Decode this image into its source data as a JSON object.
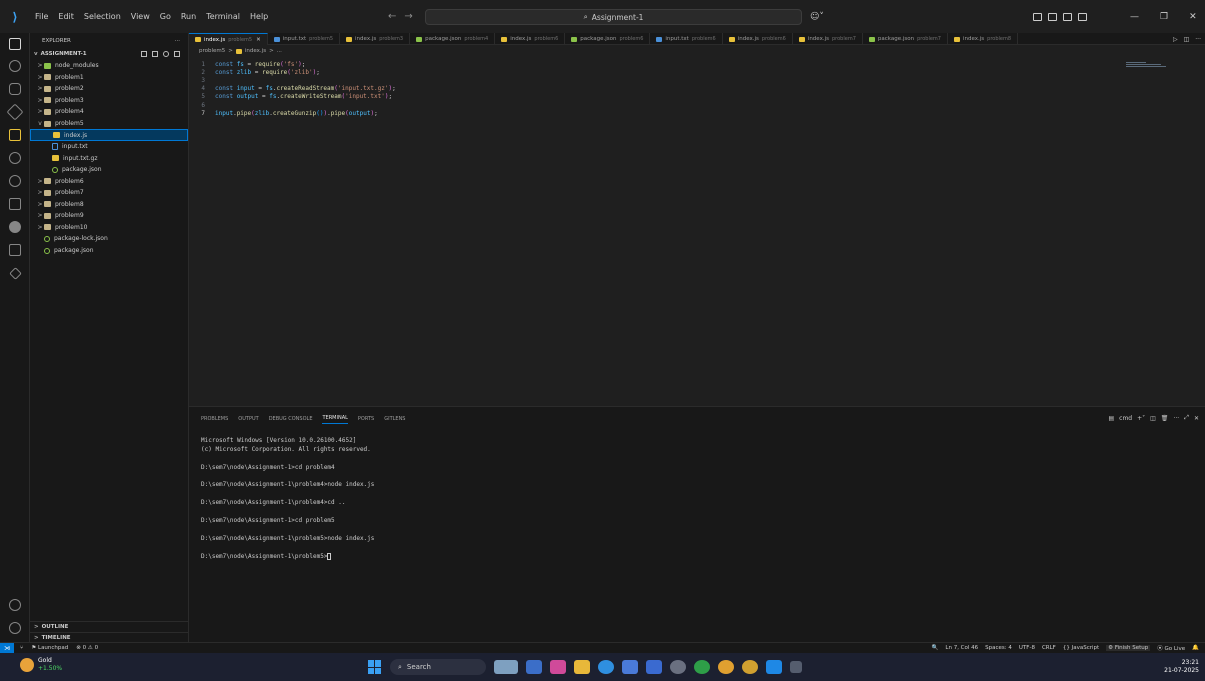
{
  "titlebar": {
    "menu": [
      "File",
      "Edit",
      "Selection",
      "View",
      "Go",
      "Run",
      "Terminal",
      "Help"
    ],
    "search_text": "Assignment-1"
  },
  "sidebar": {
    "header": "EXPLORER",
    "header_more": "···",
    "root": "ASSIGNMENT-1",
    "items": [
      {
        "label": "node_modules",
        "type": "nm",
        "indent": 1,
        "chev": ">"
      },
      {
        "label": "problem1",
        "type": "folder",
        "indent": 1,
        "chev": ">"
      },
      {
        "label": "problem2",
        "type": "folder",
        "indent": 1,
        "chev": ">"
      },
      {
        "label": "problem3",
        "type": "folder",
        "indent": 1,
        "chev": ">"
      },
      {
        "label": "problem4",
        "type": "folder",
        "indent": 1,
        "chev": ">"
      },
      {
        "label": "problem5",
        "type": "folder",
        "indent": 1,
        "chev": "v"
      },
      {
        "label": "index.js",
        "type": "js",
        "indent": 2,
        "chev": "",
        "selected": true
      },
      {
        "label": "input.txt",
        "type": "txt",
        "indent": 2,
        "chev": ""
      },
      {
        "label": "input.txt.gz",
        "type": "gz",
        "indent": 2,
        "chev": ""
      },
      {
        "label": "package.json",
        "type": "json",
        "indent": 2,
        "chev": ""
      },
      {
        "label": "problem6",
        "type": "folder",
        "indent": 1,
        "chev": ">"
      },
      {
        "label": "problem7",
        "type": "folder",
        "indent": 1,
        "chev": ">"
      },
      {
        "label": "problem8",
        "type": "folder",
        "indent": 1,
        "chev": ">"
      },
      {
        "label": "problem9",
        "type": "folder",
        "indent": 1,
        "chev": ">"
      },
      {
        "label": "problem10",
        "type": "folder",
        "indent": 1,
        "chev": ">"
      },
      {
        "label": "package-lock.json",
        "type": "json",
        "indent": 1,
        "chev": ""
      },
      {
        "label": "package.json",
        "type": "json",
        "indent": 1,
        "chev": ""
      }
    ],
    "outline": "OUTLINE",
    "timeline": "TIMELINE"
  },
  "tabs": [
    {
      "label": "index.js",
      "desc": "problem5",
      "type": "js",
      "active": true
    },
    {
      "label": "input.txt",
      "desc": "problem5",
      "type": "txt"
    },
    {
      "label": "index.js",
      "desc": "problem3",
      "type": "js"
    },
    {
      "label": "package.json",
      "desc": "problem4",
      "type": "json"
    },
    {
      "label": "index.js",
      "desc": "problem6",
      "type": "js"
    },
    {
      "label": "package.json",
      "desc": "problem6",
      "type": "json"
    },
    {
      "label": "input.txt",
      "desc": "problem6",
      "type": "txt"
    },
    {
      "label": "index.js",
      "desc": "problem6",
      "type": "js"
    },
    {
      "label": "index.js",
      "desc": "problem7",
      "type": "js"
    },
    {
      "label": "package.json",
      "desc": "problem7",
      "type": "json"
    },
    {
      "label": "index.js",
      "desc": "problem8",
      "type": "js"
    }
  ],
  "breadcrumb": {
    "folder": "problem5",
    "file": "index.js",
    "tail": "..."
  },
  "code": [
    {
      "n": "1",
      "tokens": [
        [
          "kw",
          "const "
        ],
        [
          "var",
          "fs"
        ],
        [
          "punc",
          " = "
        ],
        [
          "fn",
          "require"
        ],
        [
          "brk",
          "("
        ],
        [
          "str",
          "'fs'"
        ],
        [
          "brk",
          ")"
        ],
        [
          "punc",
          ";"
        ]
      ]
    },
    {
      "n": "2",
      "tokens": [
        [
          "kw",
          "const "
        ],
        [
          "var",
          "zlib"
        ],
        [
          "punc",
          " = "
        ],
        [
          "fn",
          "require"
        ],
        [
          "brk",
          "("
        ],
        [
          "str",
          "'zlib'"
        ],
        [
          "brk",
          ")"
        ],
        [
          "punc",
          ";"
        ]
      ]
    },
    {
      "n": "3",
      "tokens": []
    },
    {
      "n": "4",
      "tokens": [
        [
          "kw",
          "const "
        ],
        [
          "var",
          "input"
        ],
        [
          "punc",
          " = "
        ],
        [
          "var",
          "fs"
        ],
        [
          "punc",
          "."
        ],
        [
          "fn",
          "createReadStream"
        ],
        [
          "brk",
          "("
        ],
        [
          "str",
          "'input.txt.gz'"
        ],
        [
          "brk",
          ")"
        ],
        [
          "punc",
          ";"
        ]
      ]
    },
    {
      "n": "5",
      "tokens": [
        [
          "kw",
          "const "
        ],
        [
          "var",
          "output"
        ],
        [
          "punc",
          " = "
        ],
        [
          "var",
          "fs"
        ],
        [
          "punc",
          "."
        ],
        [
          "fn",
          "createWriteStream"
        ],
        [
          "brk",
          "("
        ],
        [
          "str",
          "'input.txt'"
        ],
        [
          "brk",
          ")"
        ],
        [
          "punc",
          ";"
        ]
      ]
    },
    {
      "n": "6",
      "tokens": []
    },
    {
      "n": "7",
      "tokens": [
        [
          "var",
          "input"
        ],
        [
          "punc",
          "."
        ],
        [
          "fn",
          "pipe"
        ],
        [
          "brk",
          "("
        ],
        [
          "var",
          "zlib"
        ],
        [
          "punc",
          "."
        ],
        [
          "fn",
          "createGunzip"
        ],
        [
          "brk2",
          "()"
        ],
        [
          "brk",
          ")"
        ],
        [
          "punc",
          "."
        ],
        [
          "fn",
          "pipe"
        ],
        [
          "brk",
          "("
        ],
        [
          "var",
          "output"
        ],
        [
          "brk",
          ")"
        ],
        [
          "punc",
          ";"
        ]
      ],
      "current": true
    }
  ],
  "panel": {
    "tabs": [
      "PROBLEMS",
      "OUTPUT",
      "DEBUG CONSOLE",
      "TERMINAL",
      "PORTS",
      "GITLENS"
    ],
    "active_tab": "TERMINAL",
    "terminal_name": "cmd"
  },
  "terminal": [
    "Microsoft Windows [Version 10.0.26100.4652]",
    "(c) Microsoft Corporation. All rights reserved.",
    "",
    "D:\\sem7\\node\\Assignment-1>cd problem4",
    "",
    "D:\\sem7\\node\\Assignment-1\\problem4>node index.js",
    "",
    "D:\\sem7\\node\\Assignment-1\\problem4>cd ..",
    "",
    "D:\\sem7\\node\\Assignment-1>cd problem5",
    "",
    "D:\\sem7\\node\\Assignment-1\\problem5>node index.js",
    "",
    "D:\\sem7\\node\\Assignment-1\\problem5>"
  ],
  "statusbar": {
    "launchpad": "Launchpad",
    "problems": "0",
    "warnings": "0",
    "position": "Ln 7, Col 46",
    "spaces": "Spaces: 4",
    "encoding": "UTF-8",
    "eol": "CRLF",
    "language": "JavaScript",
    "finish_setup": "Finish Setup",
    "go_live": "Go Live"
  },
  "taskbar": {
    "weather_label": "Gold",
    "weather_sub": "+1.50%",
    "search": "Search",
    "time": "23:21",
    "date": "21-07-2025"
  },
  "colors": {
    "accent": "#0078d4",
    "editor_bg": "#1f1f1f",
    "sidebar_bg": "#181818"
  }
}
